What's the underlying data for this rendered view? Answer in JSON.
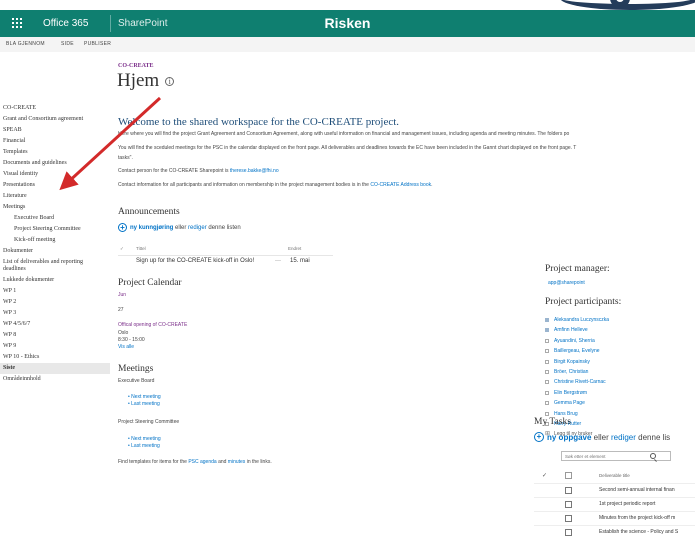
{
  "suitebar": {
    "brand": "Office 365",
    "app": "SharePoint",
    "site_name": "Risken"
  },
  "ribbon": [
    "BLA GJENNOM",
    "SIDE",
    "PUBLISER"
  ],
  "header": {
    "site": "CO-CREATE",
    "title": "Hjem"
  },
  "nav": [
    {
      "label": "CO-CREATE",
      "sub": false
    },
    {
      "label": "Grant and Consortium agreement",
      "sub": false
    },
    {
      "label": "SPEAB",
      "sub": false
    },
    {
      "label": "Financial",
      "sub": false
    },
    {
      "label": "Templates",
      "sub": false
    },
    {
      "label": "Documents and guidelines",
      "sub": false
    },
    {
      "label": "Visual identity",
      "sub": false
    },
    {
      "label": "Presentations",
      "sub": false
    },
    {
      "label": "Literature",
      "sub": false
    },
    {
      "label": "Meetings",
      "sub": false
    },
    {
      "label": "Executive Board",
      "sub": true
    },
    {
      "label": "Project Steering Committee",
      "sub": true
    },
    {
      "label": "Kick-off meeting",
      "sub": true
    },
    {
      "label": "Dokumenter",
      "sub": false
    },
    {
      "label": "List of deliverables and reporting deadlines",
      "sub": false
    },
    {
      "label": "Lukkede dokumenter",
      "sub": false
    },
    {
      "label": "WP 1",
      "sub": false
    },
    {
      "label": "WP 2",
      "sub": false
    },
    {
      "label": "WP 3",
      "sub": false
    },
    {
      "label": "WP 4/5/6/7",
      "sub": false
    },
    {
      "label": "WP 8",
      "sub": false
    },
    {
      "label": "WP 9",
      "sub": false
    },
    {
      "label": "WP 10 - Ethics",
      "sub": false
    },
    {
      "label": "Siste",
      "sub": false,
      "selected": true
    },
    {
      "label": "Områdeinnhold",
      "sub": false
    }
  ],
  "welcome": {
    "title": "Welcome to the shared workspace for the CO-CREATE project.",
    "p1": "Here where you will find the project Grant Agreement and Consortium Agreement, along with useful information on financial and management issues, including agenda and meeting minutes. The folders po",
    "p2": "You will find the sceduled meetings for the PSC in the calendar displayed on the front page. All deliverables and deadlines towards the EC have been included in the Gannt chart displayed on the front page. T",
    "p2b": "tasks\".",
    "contact_prefix": "Contact person for the CO-CREATE Sharepoint is",
    "contact_email": "therese.bakke@fhi.no",
    "address_prefix": "Contact information for all participants and information on membership in the project management bodies is in the",
    "address_link": "CO-CREATE Address book",
    "address_suffix": "."
  },
  "announcements": {
    "title": "Announcements",
    "add_strong": "ny kunngjøring",
    "add_mid": " eller ",
    "add_link": "rediger",
    "add_suffix": " denne listen",
    "col_title": "Tittel",
    "col_changed": "Endret",
    "rows": [
      {
        "title": "Sign up for the CO-CREATE kick-off in Oslo!",
        "dots": "···",
        "changed": "15. mai"
      }
    ]
  },
  "calendar": {
    "title": "Project Calendar",
    "month": "Jun",
    "day": "27",
    "event": "Offical opening of CO-CREATE",
    "location": "Oslo",
    "time": "8:30 - 15:00",
    "see_all": "Vis alle"
  },
  "meetings": {
    "title": "Meetings",
    "eb_label": "Executive Board",
    "eb_next": "Next meeting",
    "eb_last": "Last meeting",
    "psc_label": "Project Steering Committee",
    "psc_next": "Next meeting",
    "psc_last": "Last meeting",
    "footer_prefix": "Find templates for items for the",
    "footer_link1": "PSC agenda",
    "footer_and": "and",
    "footer_link2": "minutes",
    "footer_suffix": "in the links."
  },
  "right": {
    "pm_title": "Project manager:",
    "pm_email": "app@sharepoint",
    "pp_title": "Project participants:",
    "participants": [
      {
        "name": "Aleksandra Luczynsczka",
        "online": true
      },
      {
        "name": "Amfinn Helleve",
        "online": true
      },
      {
        "name": "Ayuandini, Sherria",
        "online": false
      },
      {
        "name": "Baillergeau, Evelyne",
        "online": false
      },
      {
        "name": "Birgit Kopainsky",
        "online": false
      },
      {
        "name": "Bröer, Christian",
        "online": false
      },
      {
        "name": "Christine Rivett-Carnac",
        "online": false
      },
      {
        "name": "Elin Bergstrøm",
        "online": false
      },
      {
        "name": "Gemma Page",
        "online": false
      },
      {
        "name": "Hans Brug",
        "online": false
      },
      {
        "name": "Harry Rutter",
        "online": false
      }
    ],
    "add_user": "Legg til ny bruker"
  },
  "tasks": {
    "title": "My Tasks",
    "add_strong": "ny oppgave",
    "add_mid": " eller ",
    "add_link": "rediger",
    "add_suffix": " denne lis",
    "search_placeholder": "Søk etter et element",
    "col_title": "Deliverable title",
    "rows": [
      "Second semi-annual internal finan",
      "1st project periodic report",
      "Minutes from the project kick-off m",
      "Establish the science - Policy and S"
    ]
  },
  "colors": {
    "suitebar": "#0f7f70",
    "link": "#0072c6",
    "site_title": "#7b2e8a",
    "arrow": "#d32a2a"
  }
}
